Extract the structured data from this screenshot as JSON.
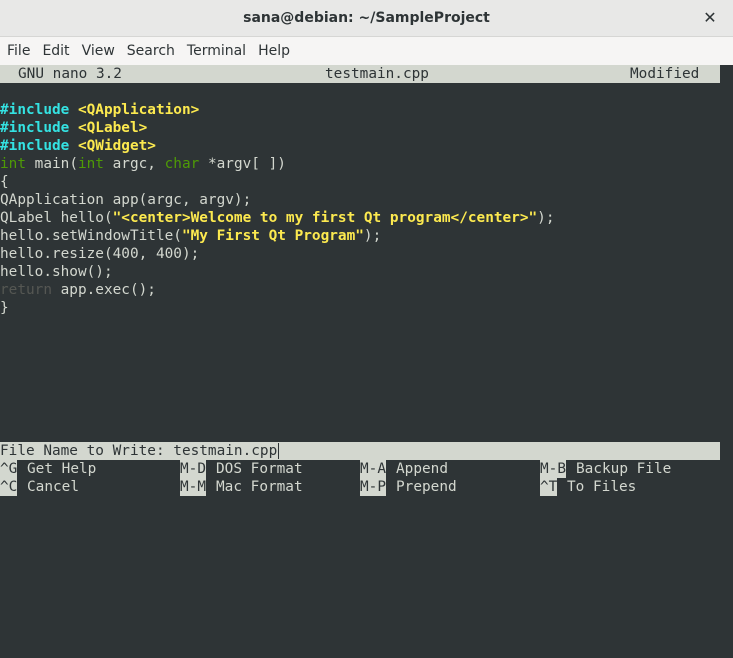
{
  "window": {
    "title": "sana@debian: ~/SampleProject",
    "close_glyph": "✕"
  },
  "menu": [
    "File",
    "Edit",
    "View",
    "Search",
    "Terminal",
    "Help"
  ],
  "nano": {
    "version": "GNU nano 3.2",
    "filename": "testmain.cpp",
    "status": "Modified"
  },
  "code": {
    "inc1_kw": "#include",
    "inc1_hdr": "<QApplication>",
    "inc2_kw": "#include",
    "inc2_hdr": "<QLabel>",
    "inc3_kw": "#include",
    "inc3_hdr": "<QWidget>",
    "main_int": "int",
    "main_mid": " main(",
    "main_int2": "int",
    "main_mid2": " argc, ",
    "main_char": "char",
    "main_end": " *argv[ ])",
    "open_brace": "{",
    "line_app": "QApplication app(argc, argv);",
    "label_pre": "QLabel hello(",
    "label_str": "\"<center>Welcome to my first Qt program</center>\"",
    "label_post": ");",
    "title_pre": "hello.setWindowTitle(",
    "title_str": "\"My First Qt Program\"",
    "title_post": ");",
    "line_resize": "hello.resize(400, 400);",
    "line_show": "hello.show();",
    "ret_kw": "return",
    "ret_rest": " app.exec();",
    "close_brace": "}"
  },
  "prompt": {
    "label": "File Name to Write: ",
    "value": "testmain.cpp"
  },
  "shortcuts": {
    "row1": [
      {
        "key": "^G",
        "label": "Get Help"
      },
      {
        "key": "M-D",
        "label": "DOS Format"
      },
      {
        "key": "M-A",
        "label": "Append"
      },
      {
        "key": "M-B",
        "label": "Backup File"
      }
    ],
    "row2": [
      {
        "key": "^C",
        "label": "Cancel"
      },
      {
        "key": "M-M",
        "label": "Mac Format"
      },
      {
        "key": "M-P",
        "label": "Prepend"
      },
      {
        "key": "^T",
        "label": "To Files"
      }
    ]
  }
}
